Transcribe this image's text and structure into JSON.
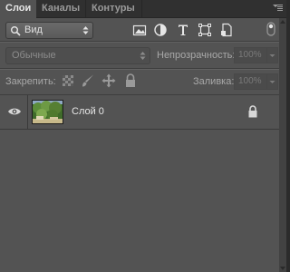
{
  "tabs": [
    {
      "label": "Слои",
      "active": true
    },
    {
      "label": "Каналы",
      "active": false
    },
    {
      "label": "Контуры",
      "active": false
    }
  ],
  "filter": {
    "selected": "Вид"
  },
  "filter_icons": [
    "image-filter-icon",
    "adjustment-filter-icon",
    "type-filter-icon",
    "shape-filter-icon",
    "smart-object-filter-icon"
  ],
  "blend": {
    "selected": "Обычные"
  },
  "opacity": {
    "label": "Непрозрачность:",
    "value": "100%"
  },
  "lock": {
    "label": "Закрепить:"
  },
  "fill": {
    "label": "Заливка:",
    "value": "100%"
  },
  "layers": [
    {
      "name": "Слой 0",
      "visible": true,
      "locked": true
    }
  ],
  "colors": {
    "panel": "#535353",
    "tabbar": "#303030"
  }
}
